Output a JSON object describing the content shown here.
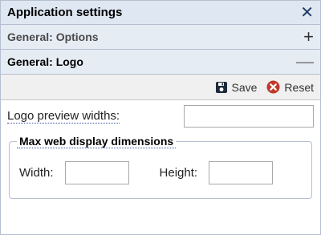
{
  "window": {
    "title": "Application settings",
    "close_symbol": "✕"
  },
  "sections": [
    {
      "label": "General: Options",
      "toggle": "+"
    },
    {
      "label": "General: Logo",
      "toggle": "—"
    }
  ],
  "toolbar": {
    "save_label": "Save",
    "reset_label": "Reset"
  },
  "logo": {
    "preview_label": "Logo preview widths:",
    "preview_value": "",
    "max_dims_legend": "Max web display dimensions",
    "width_label": "Width:",
    "width_value": "",
    "height_label": "Height:",
    "height_value": ""
  },
  "colors": {
    "header_bg": "#dfe7f2",
    "reset_icon": "#c0392b",
    "save_icon": "#1e2a3a"
  },
  "icons": {
    "save": "floppy-disk-icon",
    "reset": "red-x-circle-icon"
  }
}
